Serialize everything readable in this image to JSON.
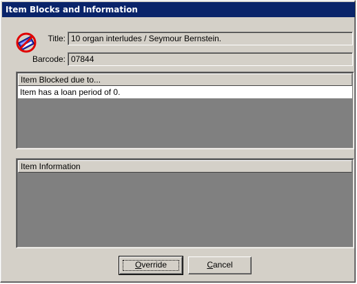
{
  "window": {
    "title": "Item Blocks and Information"
  },
  "icon": "blocked-item-icon",
  "fields": {
    "title_label": "Title:",
    "title_value": "10 organ interludes / Seymour Bernstein.",
    "barcode_label": "Barcode:",
    "barcode_value": "07844"
  },
  "blocked_panel": {
    "header": "Item Blocked due to...",
    "items": [
      "Item has a loan period of 0."
    ]
  },
  "info_panel": {
    "header": "Item Information",
    "items": []
  },
  "buttons": {
    "override": {
      "mnemonic": "O",
      "rest": "verride"
    },
    "cancel": {
      "mnemonic": "C",
      "rest": "ancel"
    }
  },
  "colors": {
    "titlebar": "#0a246a",
    "dialog_face": "#d4d0c8",
    "panel_background": "#808080",
    "list_row": "#ffffff",
    "icon_no_sign": "#e00000",
    "icon_book": "#2a3cc8"
  }
}
